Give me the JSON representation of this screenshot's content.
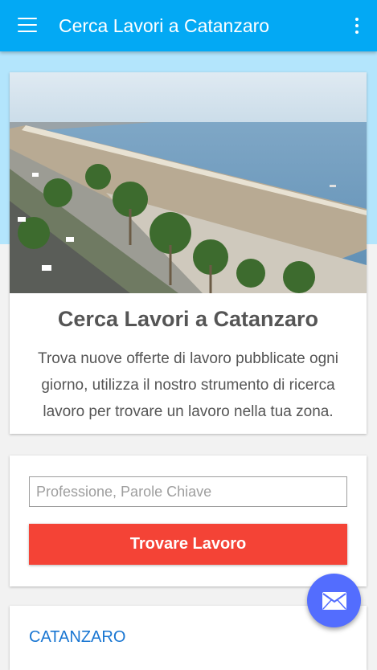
{
  "appbar": {
    "title": "Cerca Lavori a Catanzaro",
    "menu_icon": "hamburger-menu-icon",
    "overflow_icon": "more-vert-icon"
  },
  "hero": {
    "title": "Cerca Lavori a Catanzaro",
    "description": "Trova nuove offerte di lavoro pubblicate ogni giorno, utilizza il nostro strumento di ricerca lavoro per trovare un lavoro nella tua zona."
  },
  "search": {
    "placeholder": "Professione, Parole Chiave",
    "value": "",
    "button_label": "Trovare Lavoro"
  },
  "city": {
    "label": "CATANZARO"
  },
  "fab": {
    "icon": "email-icon"
  },
  "colors": {
    "primary": "#03a9f4",
    "primary_light": "#b3e5fc",
    "button_red": "#f44336",
    "fab_indigo": "#536dfe",
    "link_blue": "#1976d2"
  }
}
